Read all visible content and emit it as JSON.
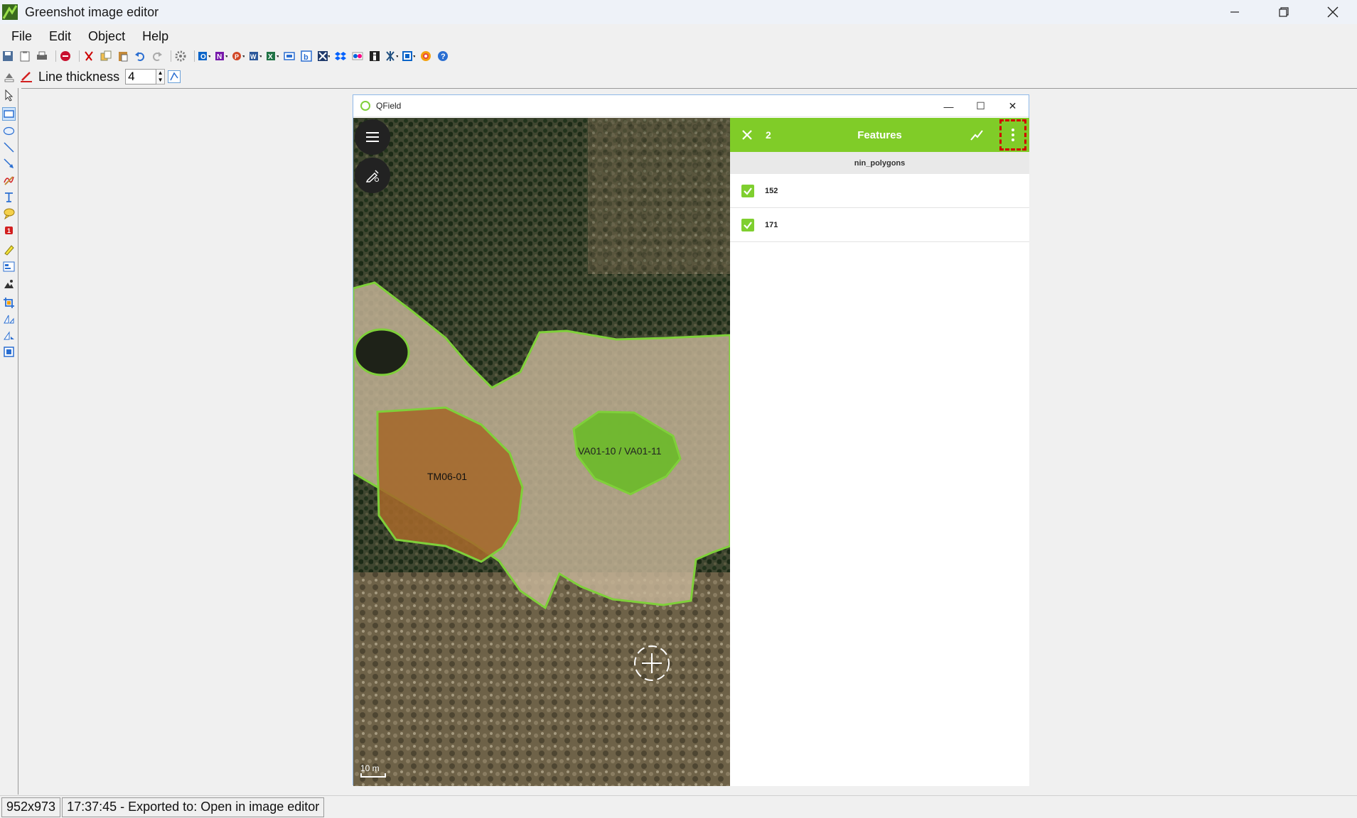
{
  "window": {
    "title": "Greenshot image editor",
    "controls": [
      "minimize",
      "restore",
      "close"
    ]
  },
  "menu": {
    "items": [
      "File",
      "Edit",
      "Object",
      "Help"
    ]
  },
  "toolbar": {
    "icons": [
      "save-icon",
      "clipboard-icon",
      "print-icon",
      "close-icon",
      "cut-icon",
      "copy-icon",
      "paste-icon",
      "undo-icon",
      "redo-icon",
      "settings-icon",
      "outlook-icon",
      "onenote-icon",
      "powerpoint-icon",
      "word-icon",
      "excel-icon",
      "monitor-icon",
      "box-icon",
      "confluence-icon",
      "dropbox-icon",
      "flickr-icon",
      "imgur-icon",
      "jira-icon",
      "photobucket-icon",
      "picasa-icon",
      "help-icon"
    ]
  },
  "line_thickness": {
    "label": "Line thickness",
    "value": "4"
  },
  "qfield": {
    "title": "QField",
    "map": {
      "labels": {
        "tm": "TM06-01",
        "va": "VA01-10 / VA01-11"
      },
      "scale": "10 m"
    },
    "features": {
      "count": "2",
      "title": "Features",
      "layer": "nin_polygons",
      "rows": [
        {
          "label": "152",
          "checked": true
        },
        {
          "label": "171",
          "checked": true
        }
      ]
    }
  },
  "status": {
    "size": "952x973",
    "message": "17:37:45 - Exported to: Open in image editor"
  },
  "colors": {
    "qfield_green": "#80cc28",
    "highlight": "#d00000"
  }
}
